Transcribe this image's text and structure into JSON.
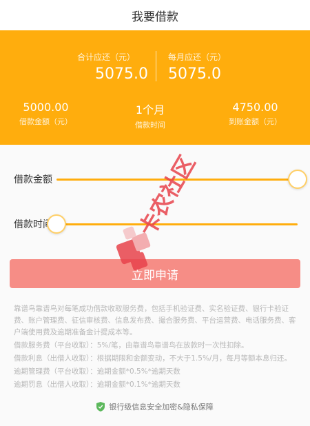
{
  "header": {
    "title": "我要借款"
  },
  "summary": {
    "total_label": "合计应还（元）",
    "total_value": "5075.0",
    "monthly_label": "每月应还（元）",
    "monthly_value": "5075.0"
  },
  "stats": [
    {
      "value": "5000.00",
      "label": "借款金额（元）"
    },
    {
      "value": "1个月",
      "label": "借款时间"
    },
    {
      "value": "4750.00",
      "label": "到账金额（元）"
    }
  ],
  "sliders": {
    "amount": {
      "label": "借款金额",
      "level": 1.0
    },
    "duration": {
      "label": "借款时间",
      "level": 0.0
    }
  },
  "apply_button": "立即申请",
  "terms": [
    "靠谱鸟靠谱鸟对每笔成功借款收取服务费，包括手机验证费、实名验证费、银行卡验证费、账户管理费、征信审核费、信息发布费、撮合服务费、平台运营费、电话服务费、客户端使用费及逾期准备金计提成本等。",
    "借款服务费（平台收取）：5%/笔，由靠谱鸟靠谱鸟在放款时一次性扣除。",
    "借款利息（出借人收取）：根据期限和金额变动，不大于1.5%/月，每月等额本息归还。",
    "逾期管理费（平台收取）：逾期金额*0.5%*逾期天数",
    "逾期罚息（出借人收取）：逾期金额*0.1%*逾期天数"
  ],
  "security_note": "银行级信息安全加密&隐私保障",
  "watermark": {
    "text": "卡农社区"
  },
  "colors": {
    "accent": "#ffad0d",
    "button": "#f68d86",
    "shield": "#5cb85c"
  }
}
